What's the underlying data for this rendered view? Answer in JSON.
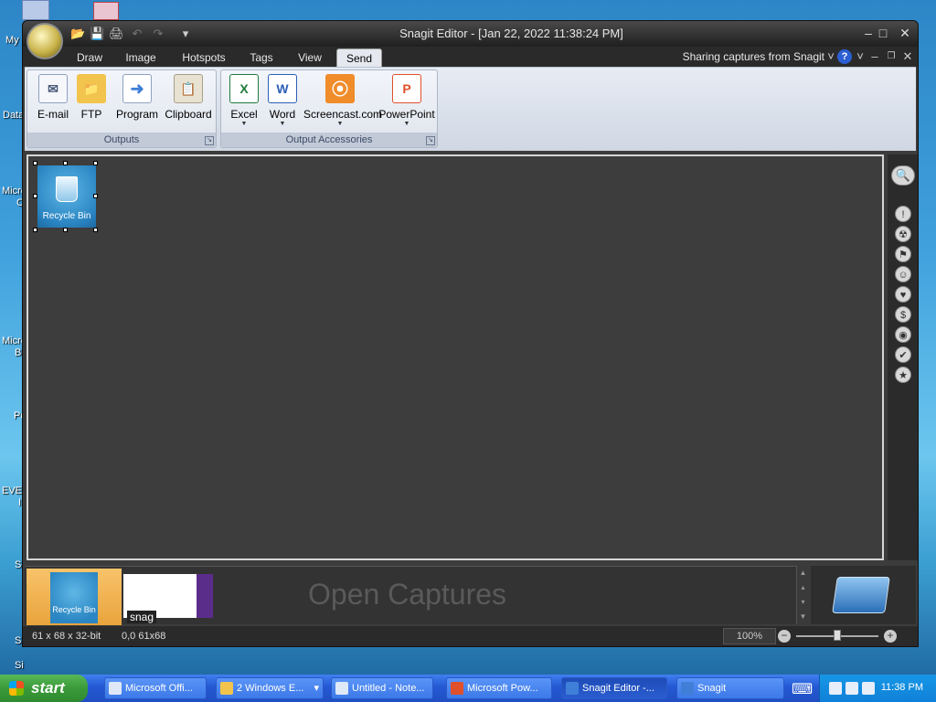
{
  "desktop": {
    "labels": [
      "My",
      "Data",
      "Micro",
      "C",
      "Micro",
      "B",
      "Po",
      "EVEF",
      "I",
      "S",
      "Si",
      "Si"
    ]
  },
  "window": {
    "title": "Snagit Editor - [Jan 22, 2022 11:38:24 PM]",
    "qat_icons": [
      "folder-open-icon",
      "save-icon",
      "print-icon",
      "undo-icon",
      "redo-icon",
      "customize-icon"
    ],
    "qat_glyphs": [
      "📂",
      "💾",
      "🖨",
      "↶",
      "↷",
      "▾"
    ],
    "controls": {
      "minimize": "–",
      "maximize": "□",
      "close": "✕"
    }
  },
  "tabs": [
    {
      "label": "Draw",
      "active": false
    },
    {
      "label": "Image",
      "active": false
    },
    {
      "label": "Hotspots",
      "active": false
    },
    {
      "label": "Tags",
      "active": false
    },
    {
      "label": "View",
      "active": false
    },
    {
      "label": "Send",
      "active": true
    }
  ],
  "sharing_text": "Sharing captures from Snagit",
  "sharing_dropdown": "˅",
  "help_label": "?",
  "help_dropdown": "˅",
  "inner_controls": {
    "minimize": "–",
    "restore": "❐",
    "close": "✕"
  },
  "ribbon": {
    "outputs": {
      "label": "Outputs",
      "launcher": "↘",
      "buttons": [
        {
          "label": "E-mail",
          "icon": "email-icon",
          "glyph": "✉",
          "color": "#f5f7fb"
        },
        {
          "label": "FTP",
          "icon": "ftp-icon",
          "glyph": "📁",
          "color": "#f2c44d"
        },
        {
          "label": "Program",
          "icon": "program-icon",
          "glyph": "➜",
          "color": "#3f7fd8"
        },
        {
          "label": "Clipboard",
          "icon": "clipboard-icon",
          "glyph": "📋",
          "color": "#e8e2d2"
        }
      ]
    },
    "output_accessories": {
      "label": "Output Accessories",
      "launcher": "↘",
      "dropdown_glyph": "▼",
      "buttons": [
        {
          "label": "Excel",
          "icon": "excel-icon",
          "glyph": "X",
          "color": "#1f7a3a"
        },
        {
          "label": "Word",
          "icon": "word-icon",
          "glyph": "W",
          "color": "#2b5fb8"
        },
        {
          "label": "Screencast.com",
          "icon": "screencast-icon",
          "glyph": "⦿",
          "color": "#f08c2a"
        },
        {
          "label": "PowerPoint",
          "icon": "powerpoint-icon",
          "glyph": "P",
          "color": "#e0502a"
        }
      ]
    }
  },
  "canvas": {
    "capture_label": "Recycle Bin"
  },
  "sidebar": {
    "search_glyph": "🔍",
    "icons": [
      {
        "name": "stamp-exclamation-icon",
        "glyph": "!"
      },
      {
        "name": "stamp-radiation-icon",
        "glyph": "☢"
      },
      {
        "name": "stamp-flag-icon",
        "glyph": "⚑"
      },
      {
        "name": "stamp-smiley-icon",
        "glyph": "☺"
      },
      {
        "name": "stamp-heart-icon",
        "glyph": "♥"
      },
      {
        "name": "stamp-dollar-icon",
        "glyph": "$"
      },
      {
        "name": "stamp-pin-icon",
        "glyph": "◉"
      },
      {
        "name": "stamp-check-icon",
        "glyph": "✔"
      },
      {
        "name": "stamp-star-icon",
        "glyph": "★"
      }
    ]
  },
  "tray": {
    "placeholder": "Open Captures",
    "thumbs": [
      {
        "label": "Recycle Bin"
      },
      {
        "label": "snag"
      }
    ],
    "scroll_glyphs": [
      "▲",
      "▴",
      "▾",
      "▼"
    ]
  },
  "status": {
    "dimensions": "61 x 68 x 32-bit",
    "selection": "0,0  61x68",
    "zoom": "100%",
    "zoom_level": 0.5,
    "zoom_minus": "−",
    "zoom_plus": "+"
  },
  "taskbar": {
    "start_label": "start",
    "tasks": [
      {
        "label": "Microsoft Offi...",
        "icon": "office-icon",
        "active": false
      },
      {
        "label": "2 Windows E...",
        "icon": "folder-icon",
        "active": false
      },
      {
        "label": "Untitled - Note...",
        "icon": "notepad-icon",
        "active": false
      },
      {
        "label": "Microsoft Pow...",
        "icon": "powerpoint-icon",
        "active": false
      },
      {
        "label": "Snagit Editor -...",
        "icon": "snagit-editor-icon",
        "active": true
      },
      {
        "label": "Snagit",
        "icon": "snagit-icon",
        "active": false
      }
    ],
    "group_dropdown": "▾",
    "keyboard_icon": "⌨",
    "clock": "11:38 PM"
  }
}
